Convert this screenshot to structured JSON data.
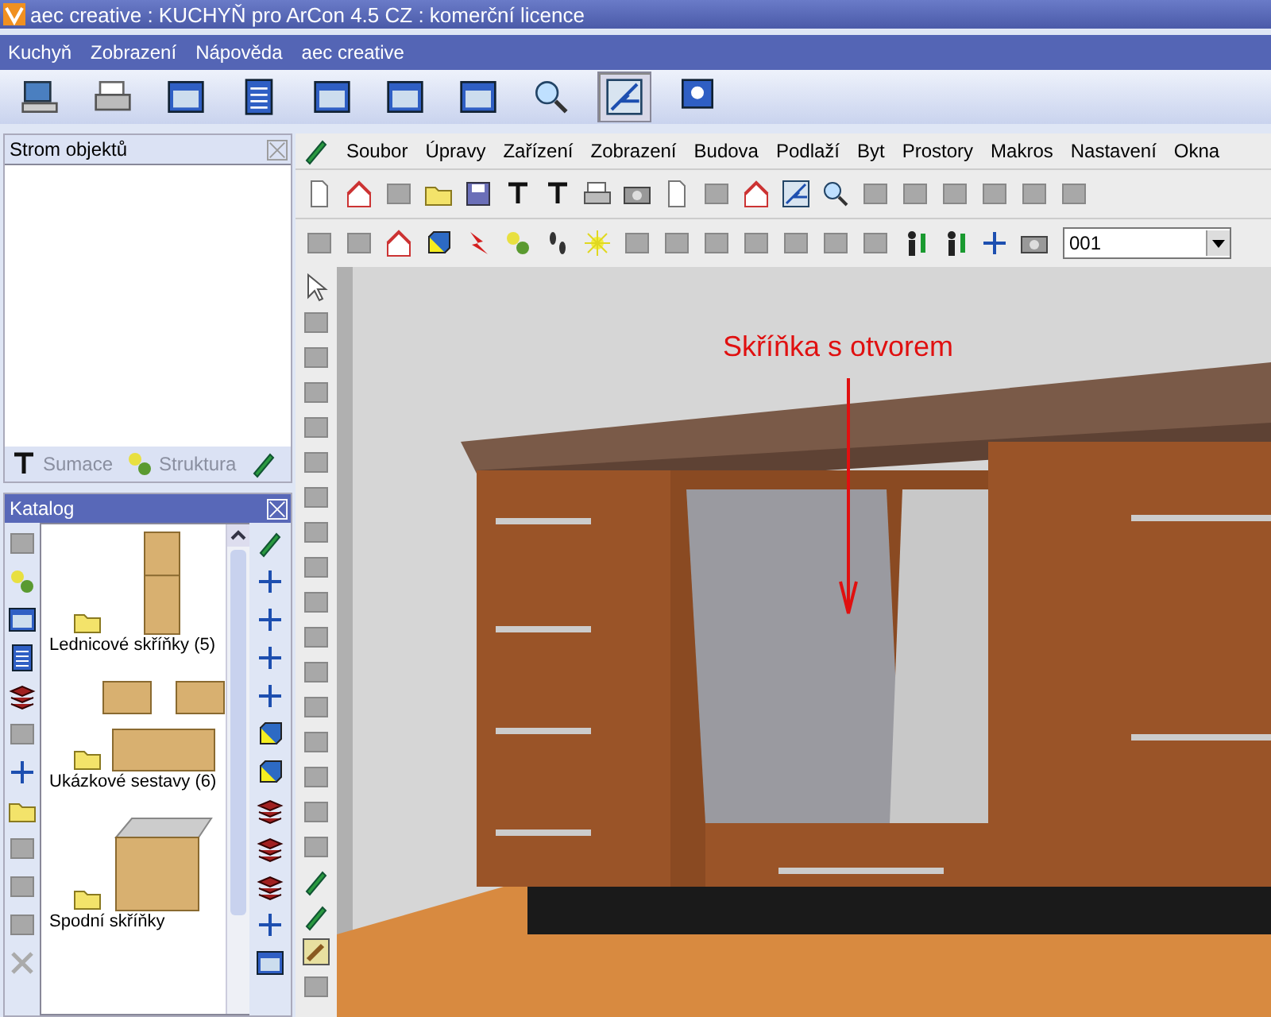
{
  "window": {
    "title": "aec creative : KUCHYŇ pro ArCon 4.5 CZ : komerční licence"
  },
  "app_menu": [
    "Kuchyň",
    "Zobrazení",
    "Nápověda",
    "aec creative"
  ],
  "main_toolbar": [
    {
      "selected": false
    },
    {
      "selected": false
    },
    {
      "selected": false
    },
    {
      "selected": false
    },
    {
      "selected": false
    },
    {
      "selected": false
    },
    {
      "selected": false
    },
    {
      "selected": false
    },
    {
      "selected": true
    },
    {
      "selected": false
    }
  ],
  "object_tree": {
    "title": "Strom objektů",
    "footer": [
      {
        "label": "Sumace",
        "disabled": true
      },
      {
        "label": "Struktura",
        "disabled": true
      }
    ]
  },
  "catalog": {
    "title": "Katalog",
    "items": [
      "Lednicové skříňky (5)",
      "Ukázkové sestavy (6)",
      "Spodní skříňky"
    ]
  },
  "menu": [
    "Soubor",
    "Úpravy",
    "Zařízení",
    "Zobrazení",
    "Budova",
    "Podlaží",
    "Byt",
    "Prostory",
    "Makros",
    "Nastavení",
    "Okna"
  ],
  "floor_combo": {
    "value": "001"
  },
  "annotation": {
    "text": "Skříňka s otvorem"
  }
}
